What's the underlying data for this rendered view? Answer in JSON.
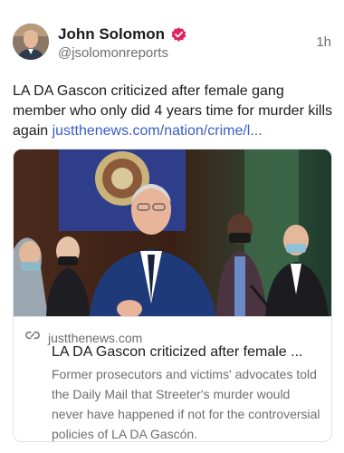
{
  "post": {
    "author_name": "John Solomon",
    "author_handle": "@jsolomonreports",
    "time": "1h",
    "text": "LA DA Gascon criticized after female gang member who only did 4 years time for murder kills again ",
    "link_text": "justthenews.com/nation/crime/l...",
    "verified_color": "#e0245e"
  },
  "link_card": {
    "domain": "justthenews.com",
    "title": "LA DA Gascon criticized after female ...",
    "description": "Former prosecutors and victims' advocates told the Daily Mail that Streeter's murder would never have happened if not for the controversial policies of LA DA Gascón.",
    "link_icon": "link-icon"
  },
  "icons": {
    "verified": "verified-badge-icon",
    "avatar": "avatar"
  }
}
